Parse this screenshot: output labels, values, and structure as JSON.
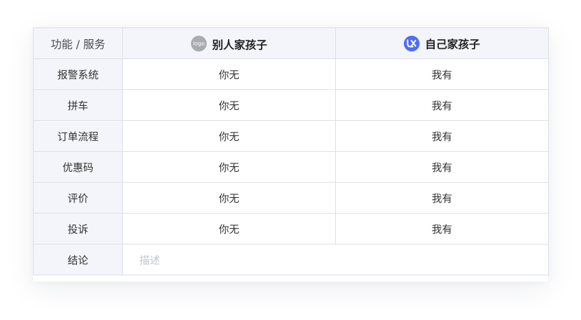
{
  "header": {
    "feature_label": "功能 / 服务",
    "competitor": {
      "logo_text": "logo",
      "name": "别人家孩子"
    },
    "ours": {
      "name": "自己家孩子",
      "logo_color": "#4f6ef7"
    }
  },
  "rows": [
    {
      "feature": "报警系统",
      "competitor": "你无",
      "ours": "我有"
    },
    {
      "feature": "拼车",
      "competitor": "你无",
      "ours": "我有"
    },
    {
      "feature": "订单流程",
      "competitor": "你无",
      "ours": "我有"
    },
    {
      "feature": "优惠码",
      "competitor": "你无",
      "ours": "我有"
    },
    {
      "feature": "评价",
      "competitor": "你无",
      "ours": "我有"
    },
    {
      "feature": "投诉",
      "competitor": "你无",
      "ours": "我有"
    }
  ],
  "conclusion": {
    "label": "结论",
    "placeholder": "描述"
  }
}
